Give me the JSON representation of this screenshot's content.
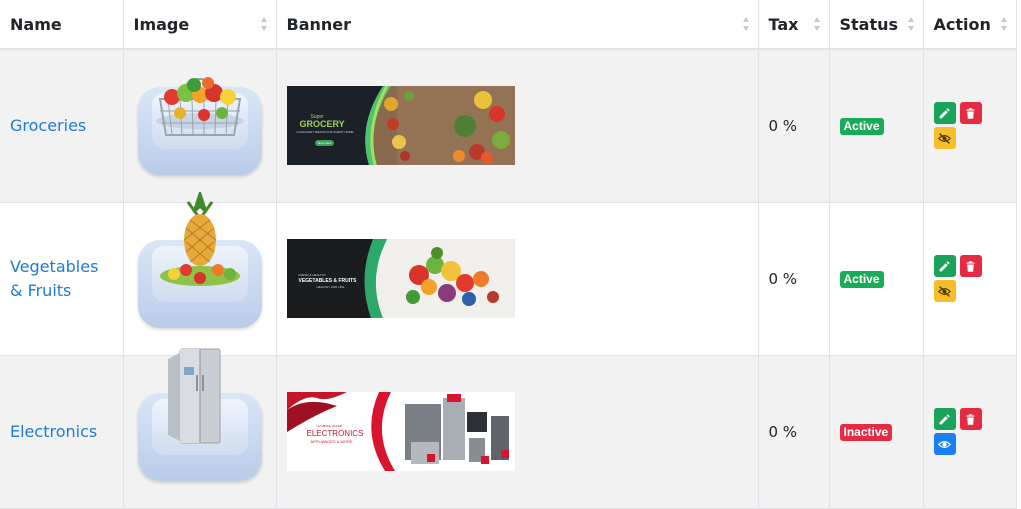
{
  "columns": [
    {
      "label": "Name",
      "sortable": false
    },
    {
      "label": "Image",
      "sortable": true
    },
    {
      "label": "Banner",
      "sortable": true
    },
    {
      "label": "Tax",
      "sortable": true
    },
    {
      "label": "Status",
      "sortable": true
    },
    {
      "label": "Action",
      "sortable": true
    }
  ],
  "rows": [
    {
      "name_line1": "Groceries",
      "name_line2": "",
      "image_icon": "grocery-basket-image",
      "banner": {
        "style": "grocery",
        "title_small": "Super",
        "title": "GROCERY",
        "subtitle": "A GROCERY BRAND FOR EVERY HOME",
        "button": "Shop Now"
      },
      "tax": "0 %",
      "status": "Active",
      "visibility_icon": "eye-slash-icon"
    },
    {
      "name_line1": "Vegetables",
      "name_line2": "& Fruits",
      "image_icon": "pineapple-vegetables-image",
      "banner": {
        "style": "veg",
        "title_small": "FRESH & HEALTHY",
        "title": "VEGETABLES & FRUITS",
        "subtitle": "HEALTHY FOR LIFE",
        "button": ""
      },
      "tax": "0 %",
      "status": "Active",
      "visibility_icon": "eye-slash-icon"
    },
    {
      "name_line1": "Electronics",
      "name_line2": "",
      "image_icon": "refrigerator-image",
      "banner": {
        "style": "electronics",
        "title_small": "ULTIMATE OFFER",
        "title": "ELECTRONICS",
        "subtitle": "APPLIANCES & MORE",
        "button": ""
      },
      "tax": "0 %",
      "status": "Inactive",
      "visibility_icon": "eye-icon"
    }
  ],
  "colors": {
    "link": "#1e7bd4",
    "active": "#1aab5a",
    "inactive": "#e32b44",
    "edit": "#19a45a",
    "delete": "#e32b44",
    "hide": "#f6be2a",
    "show": "#1a7ff0"
  }
}
